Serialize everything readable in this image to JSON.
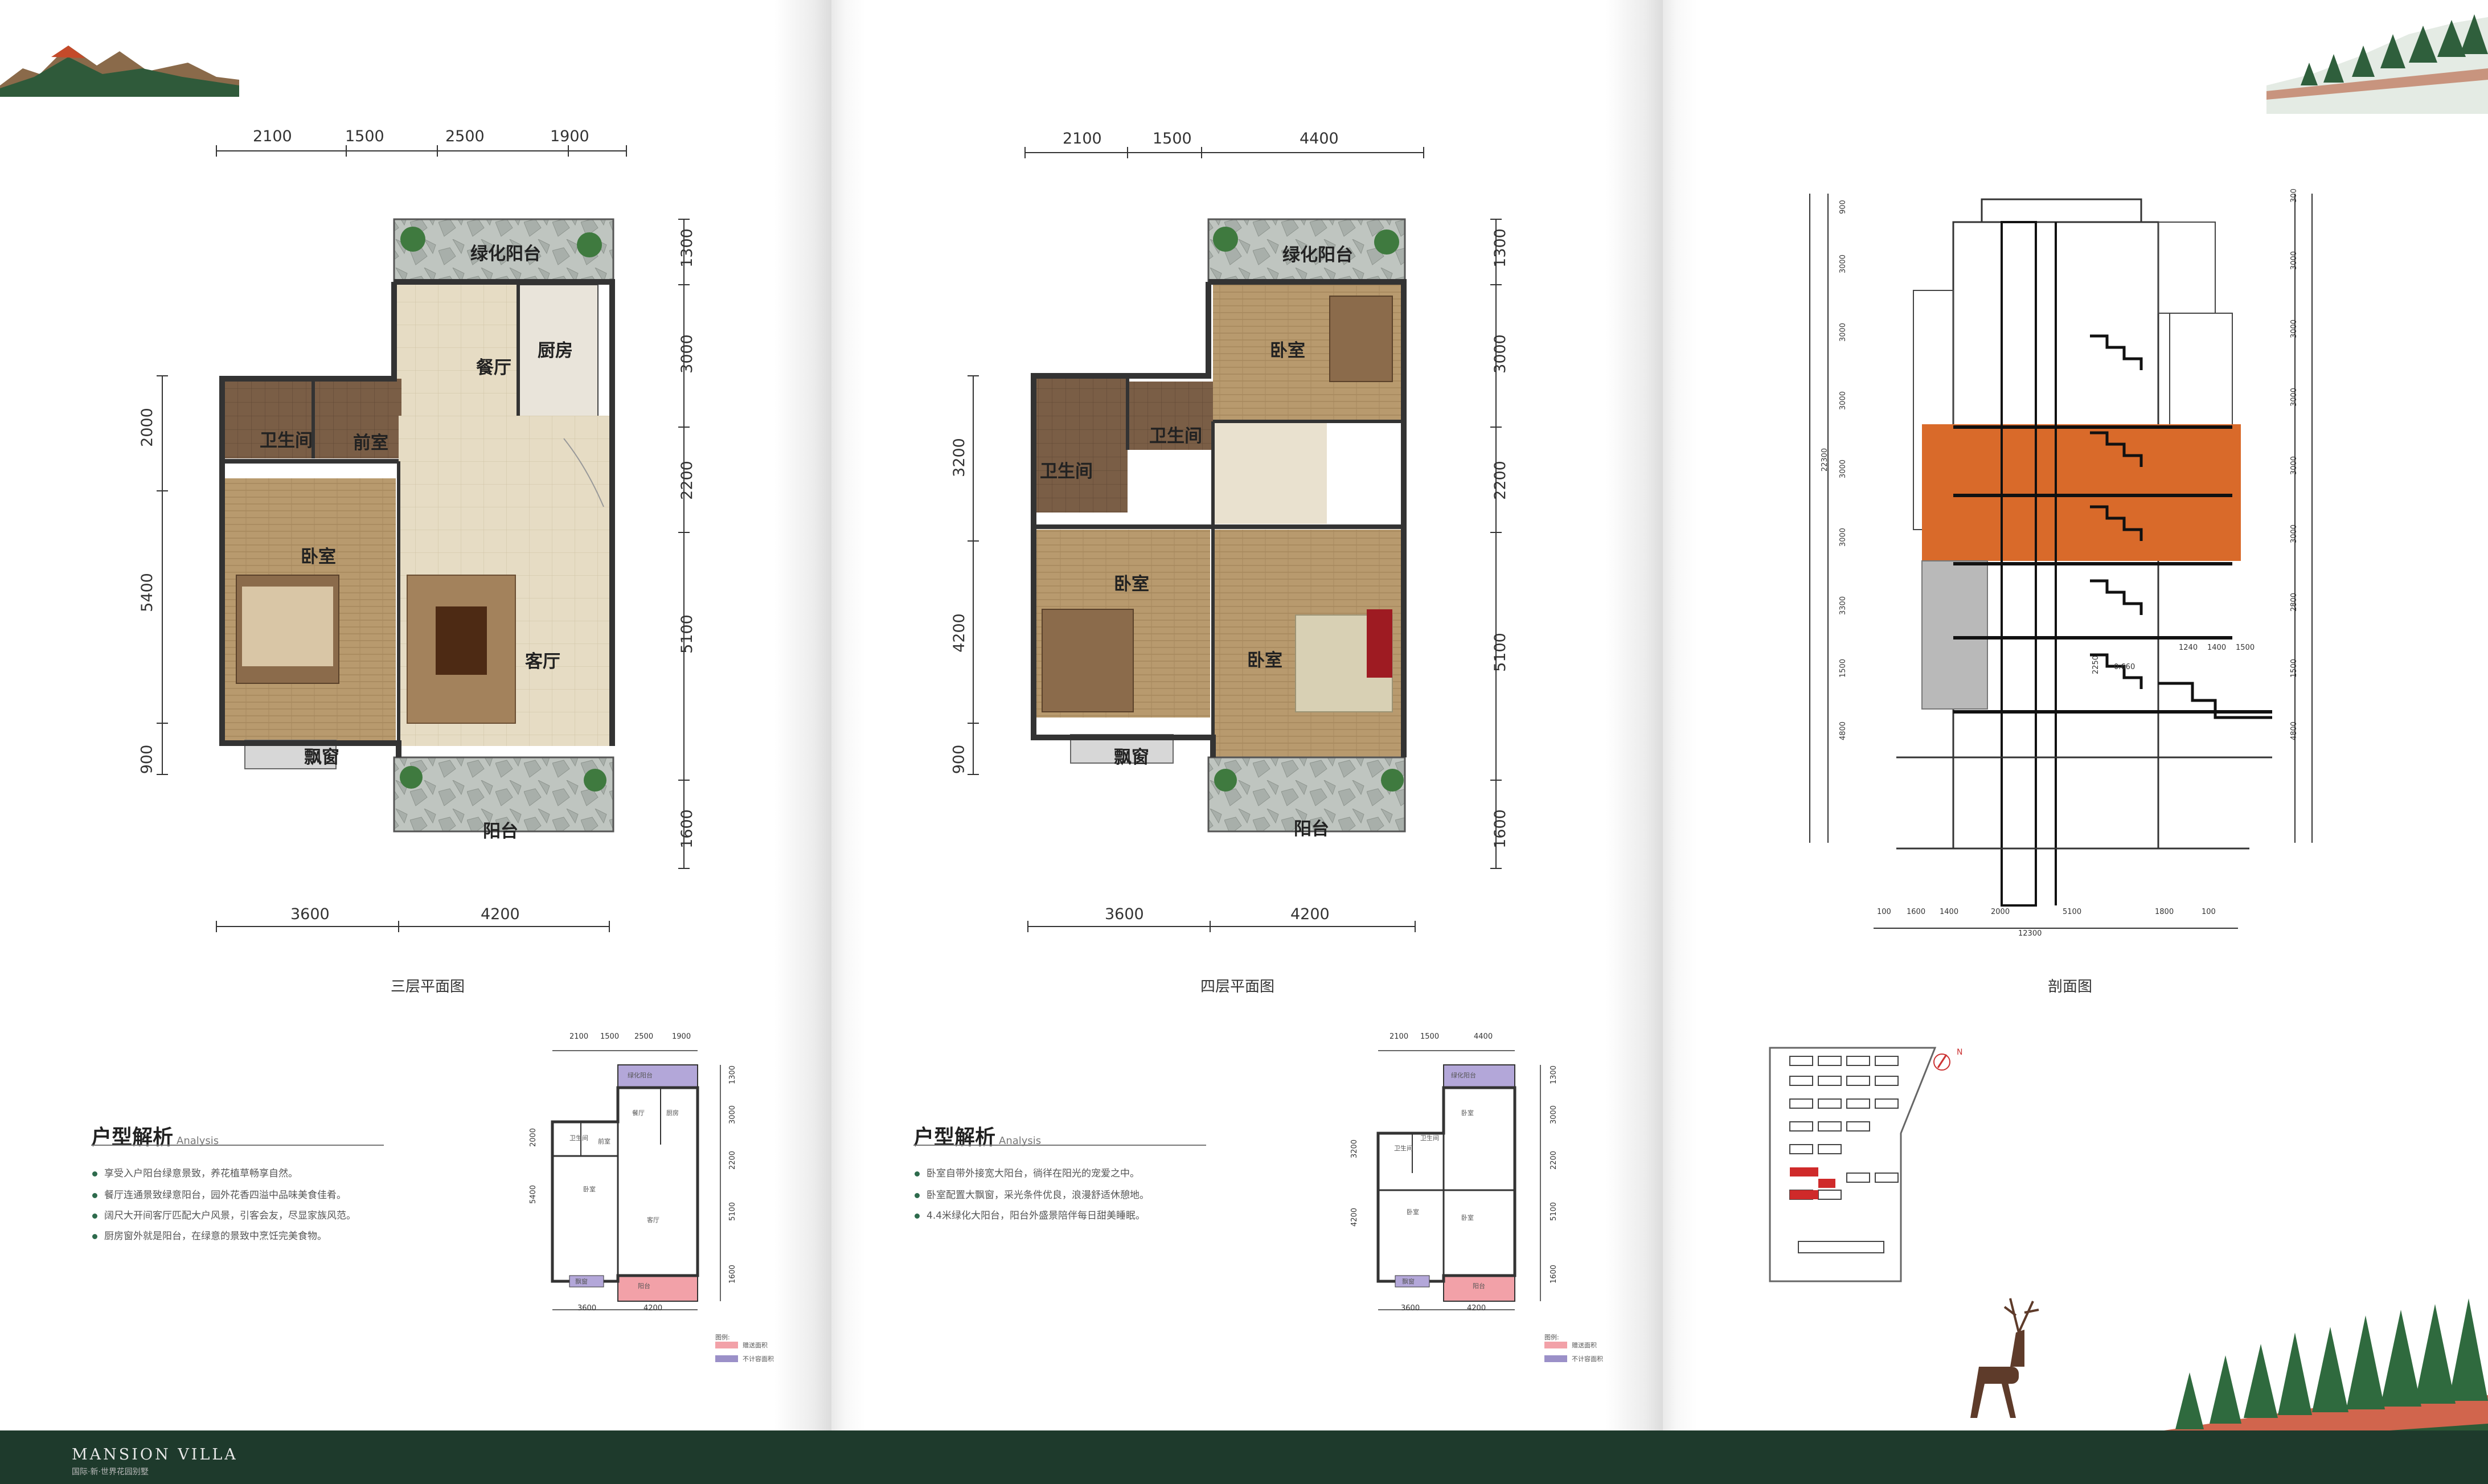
{
  "colors": {
    "footer": "#1e3a2c",
    "accent_green": "#2e6b4d",
    "highlight_orange": "#d96a2a",
    "legend_pink": "#f2a1a8",
    "legend_purple": "#9b90c8"
  },
  "brand": {
    "name": "MANSION VILLA",
    "sub": "国际·新·世界花园别墅"
  },
  "floor3": {
    "caption": "三层平面图",
    "top_dims": [
      "2100",
      "1500",
      "2500",
      "1900"
    ],
    "bottom_dims": [
      "3600",
      "4200"
    ],
    "left_dims": [
      "2000",
      "5400",
      "900"
    ],
    "right_dims": [
      "1300",
      "3000",
      "2200",
      "5100",
      "1600"
    ],
    "rooms": {
      "green_balcony": "绿化阳台",
      "dining": "餐厅",
      "kitchen": "厨房",
      "bathroom": "卫生间",
      "foyer": "前室",
      "bedroom": "卧室",
      "living": "客厅",
      "bay_window": "飘窗",
      "balcony": "阳台"
    }
  },
  "floor4": {
    "caption": "四层平面图",
    "top_dims": [
      "2100",
      "1500",
      "4400"
    ],
    "bottom_dims": [
      "3600",
      "4200"
    ],
    "left_dims": [
      "3200",
      "4200",
      "900"
    ],
    "right_dims": [
      "1300",
      "3000",
      "2200",
      "5100",
      "1600"
    ],
    "rooms": {
      "green_balcony": "绿化阳台",
      "bedroom_top": "卧室",
      "bathroom_a": "卫生间",
      "bathroom_b": "卫生间",
      "bedroom_left": "卧室",
      "bedroom_right": "卧室",
      "bay_window": "飘窗",
      "balcony": "阳台"
    }
  },
  "section": {
    "caption": "剖面图",
    "left_dims": [
      "900",
      "3000",
      "3000",
      "3000",
      "3000",
      "3000",
      "3300",
      "1500",
      "4800"
    ],
    "overall_left": "22300",
    "right_dims": [
      "300",
      "3000",
      "3000",
      "3000",
      "3000",
      "3000",
      "2800",
      "1500",
      "4800"
    ],
    "bottom_dims": [
      "100",
      "1600",
      "1400",
      "2000",
      "5100",
      "1800",
      "100"
    ],
    "overall_bottom": "12300",
    "inner_dims": [
      "1240",
      "1400",
      "1500",
      "2250"
    ],
    "level_mark": "0.660"
  },
  "analysis3": {
    "title": "户型解析",
    "sub": "Analysis",
    "bullets": [
      "享受入户阳台绿意景致，养花植草畅享自然。",
      "餐厅连通景致绿意阳台，园外花香四溢中品味美食佳肴。",
      "阔尺大开间客厅匹配大户风景，引客会友，尽显家族风范。",
      "厨房窗外就是阳台，在绿意的景致中烹饪完美食物。"
    ]
  },
  "analysis4": {
    "title": "户型解析",
    "sub": "Analysis",
    "bullets": [
      "卧室自带外接宽大阳台，徜徉在阳光的宠爱之中。",
      "卧室配置大飘窗，采光条件优良，浪漫舒适休憩地。",
      "4.4米绿化大阳台，阳台外盛景陪伴每日甜美睡眠。"
    ]
  },
  "mini3": {
    "top_dims": [
      "2100",
      "1500",
      "2500",
      "1900"
    ],
    "bottom_dims": [
      "3600",
      "4200"
    ],
    "left_dims": [
      "2000",
      "5400"
    ],
    "right_dims": [
      "1300",
      "3000",
      "2200",
      "5100",
      "1600"
    ],
    "rooms": {
      "green_balcony": "绿化阳台",
      "dining": "餐厅",
      "kitchen": "厨房",
      "bathroom": "卫生间",
      "foyer": "前室",
      "bedroom": "卧室",
      "living": "客厅",
      "bay_window": "飘窗",
      "balcony": "阳台"
    },
    "legend_title": "图例:",
    "legend": [
      "赠送面积",
      "不计容面积"
    ]
  },
  "mini4": {
    "top_dims": [
      "2100",
      "1500",
      "4400"
    ],
    "bottom_dims": [
      "3600",
      "4200"
    ],
    "left_dims": [
      "3200",
      "4200"
    ],
    "right_dims": [
      "1300",
      "3000",
      "2200",
      "5100",
      "1600"
    ],
    "rooms": {
      "green_balcony": "绿化阳台",
      "bedroom_top": "卧室",
      "bathroom_a": "卫生间",
      "bathroom_b": "卫生间",
      "bedroom_left": "卧室",
      "bedroom_right": "卧室",
      "bay_window": "飘窗",
      "balcony": "阳台"
    },
    "legend_title": "图例:",
    "legend": [
      "赠送面积",
      "不计容面积"
    ]
  },
  "siteplan": {
    "compass": "N"
  }
}
